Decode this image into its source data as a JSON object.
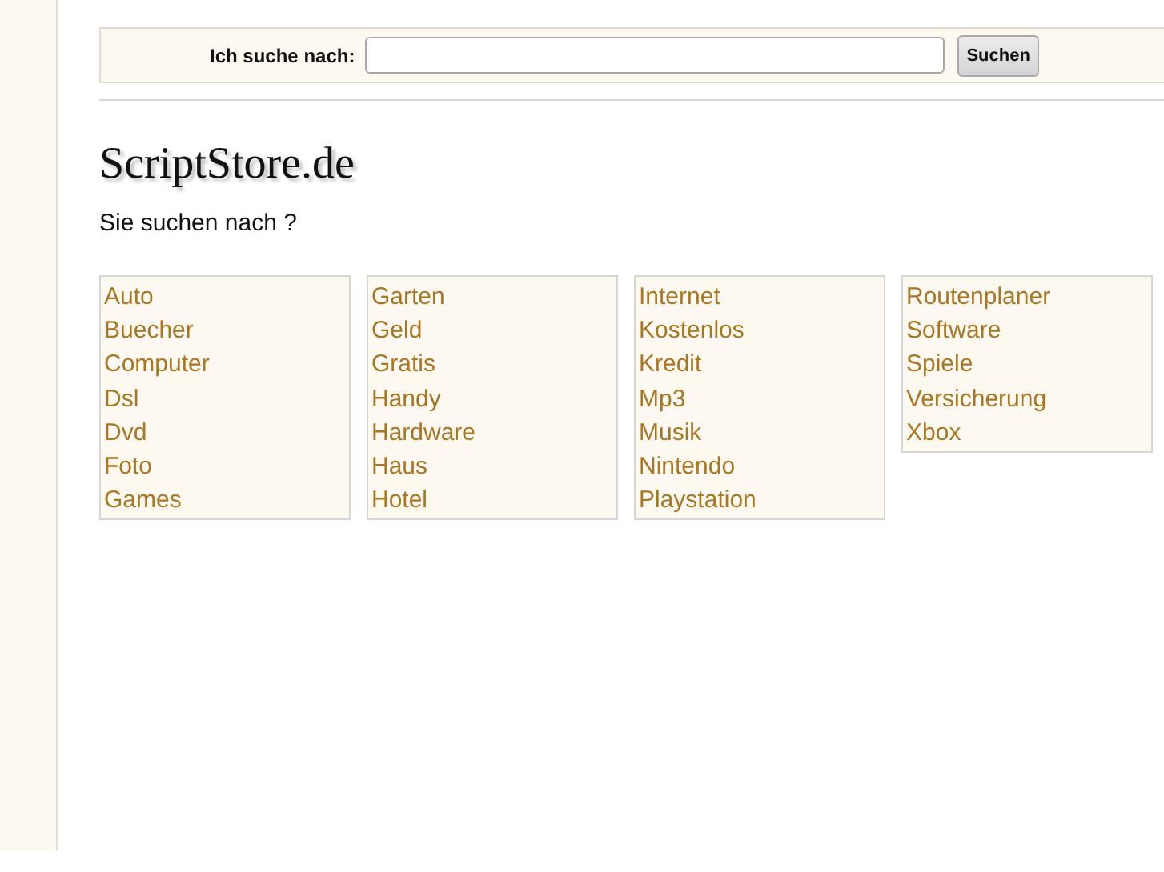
{
  "search": {
    "label": "Ich suche nach:",
    "button": "Suchen"
  },
  "logo": "ScriptStore.de",
  "prompt": "Sie suchen nach ?",
  "columns": [
    {
      "links": [
        "Auto",
        "Buecher",
        "Computer",
        "Dsl",
        "Dvd",
        "Foto",
        "Games"
      ]
    },
    {
      "links": [
        "Garten",
        "Geld",
        "Gratis",
        "Handy",
        "Hardware",
        "Haus",
        "Hotel"
      ]
    },
    {
      "links": [
        "Internet",
        "Kostenlos",
        "Kredit",
        "Mp3",
        "Musik",
        "Nintendo",
        "Playstation"
      ]
    },
    {
      "links": [
        "Routenplaner",
        "Software",
        "Spiele",
        "Versicherung",
        "Xbox"
      ]
    }
  ]
}
